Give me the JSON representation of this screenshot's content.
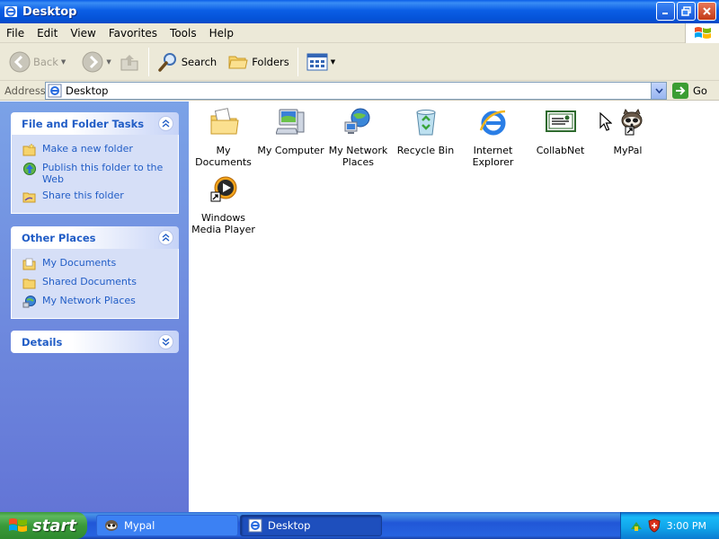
{
  "window": {
    "title": "Desktop",
    "title_icon": "ie-folder-icon"
  },
  "menu": [
    "File",
    "Edit",
    "View",
    "Favorites",
    "Tools",
    "Help"
  ],
  "toolbar": {
    "back_label": "Back",
    "search_label": "Search",
    "folders_label": "Folders"
  },
  "address": {
    "label": "Address",
    "value": "Desktop",
    "go_label": "Go"
  },
  "task_pane": {
    "file_tasks": {
      "title": "File and Folder Tasks",
      "items": [
        {
          "label": "Make a new folder",
          "icon": "new-folder-icon"
        },
        {
          "label": "Publish this folder to the Web",
          "icon": "publish-web-icon"
        },
        {
          "label": "Share this folder",
          "icon": "share-folder-icon"
        }
      ]
    },
    "other_places": {
      "title": "Other Places",
      "items": [
        {
          "label": "My Documents",
          "icon": "my-documents-icon"
        },
        {
          "label": "Shared Documents",
          "icon": "shared-documents-icon"
        },
        {
          "label": "My Network Places",
          "icon": "network-places-icon"
        }
      ]
    },
    "details": {
      "title": "Details"
    }
  },
  "desktop_icons": [
    {
      "label": "My Documents",
      "icon": "my-documents-icon"
    },
    {
      "label": "My Computer",
      "icon": "my-computer-icon"
    },
    {
      "label": "My Network Places",
      "icon": "network-places-icon"
    },
    {
      "label": "Recycle Bin",
      "icon": "recycle-bin-icon"
    },
    {
      "label": "Internet Explorer",
      "icon": "internet-explorer-icon"
    },
    {
      "label": "CollabNet",
      "icon": "collabnet-icon"
    },
    {
      "label": "MyPal",
      "icon": "mypal-icon"
    },
    {
      "label": "Windows Media Player",
      "icon": "media-player-icon"
    }
  ],
  "taskbar": {
    "start_label": "start",
    "buttons": [
      {
        "label": "Mypal",
        "active": false
      },
      {
        "label": "Desktop",
        "active": true
      }
    ],
    "clock": "3:00 PM"
  },
  "colors": {
    "titlebar_blue": "#0553d8",
    "task_link": "#215dc6",
    "taskpane_bg": "#6f8ce0",
    "start_green": "#3a9a3a"
  }
}
